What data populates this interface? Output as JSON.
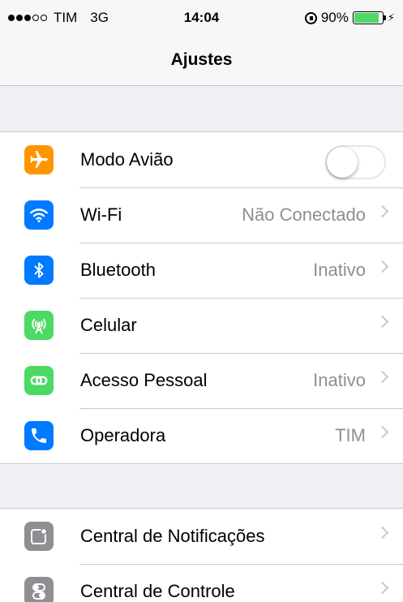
{
  "status_bar": {
    "carrier": "TIM",
    "network": "3G",
    "time": "14:04",
    "battery": "90%",
    "battery_level": 0.9,
    "signal_bars_filled": 3,
    "signal_bars_total": 5
  },
  "nav": {
    "title": "Ajustes"
  },
  "colors": {
    "orange": "#ff9500",
    "blue": "#007aff",
    "green": "#4cd964",
    "gray": "#8e8e93"
  },
  "group1": [
    {
      "label": "Modo Avião",
      "icon": "airplane-icon",
      "control": "toggle",
      "toggle_on": false
    },
    {
      "label": "Wi-Fi",
      "icon": "wifi-icon",
      "value": "Não Conectado"
    },
    {
      "label": "Bluetooth",
      "icon": "bluetooth-icon",
      "value": "Inativo"
    },
    {
      "label": "Celular",
      "icon": "cellular-antenna-icon",
      "value": ""
    },
    {
      "label": "Acesso Pessoal",
      "icon": "personal-hotspot-icon",
      "value": "Inativo"
    },
    {
      "label": "Operadora",
      "icon": "phone-icon",
      "value": "TIM"
    }
  ],
  "group2": [
    {
      "label": "Central de Notificações",
      "icon": "notification-center-icon"
    },
    {
      "label": "Central de Controle",
      "icon": "control-center-icon"
    }
  ]
}
